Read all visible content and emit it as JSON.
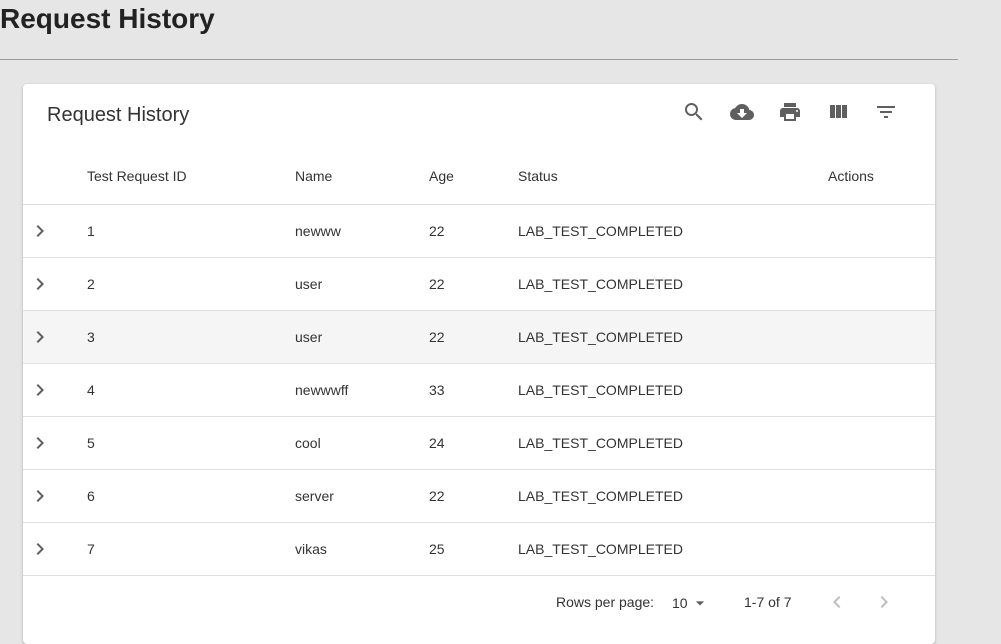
{
  "page": {
    "heading": "Request History"
  },
  "card": {
    "title": "Request History",
    "toolbar_icons": [
      "search-icon",
      "cloud-download-icon",
      "print-icon",
      "view-column-icon",
      "filter-list-icon"
    ]
  },
  "table": {
    "columns": [
      "Test Request ID",
      "Name",
      "Age",
      "Status",
      "Actions"
    ],
    "rows": [
      {
        "id": "1",
        "name": "newww",
        "age": "22",
        "status": "LAB_TEST_COMPLETED"
      },
      {
        "id": "2",
        "name": "user",
        "age": "22",
        "status": "LAB_TEST_COMPLETED"
      },
      {
        "id": "3",
        "name": "user",
        "age": "22",
        "status": "LAB_TEST_COMPLETED"
      },
      {
        "id": "4",
        "name": "newwwff",
        "age": "33",
        "status": "LAB_TEST_COMPLETED"
      },
      {
        "id": "5",
        "name": "cool",
        "age": "24",
        "status": "LAB_TEST_COMPLETED"
      },
      {
        "id": "6",
        "name": "server",
        "age": "22",
        "status": "LAB_TEST_COMPLETED"
      },
      {
        "id": "7",
        "name": "vikas",
        "age": "25",
        "status": "LAB_TEST_COMPLETED"
      }
    ]
  },
  "pagination": {
    "rows_per_page_label": "Rows per page:",
    "rows_per_page_value": "10",
    "range": "1-7 of 7"
  },
  "colors": {
    "background": "#e6e6e6",
    "card": "#ffffff",
    "hover_row": "#f5f5f5",
    "icon": "#5f5f5f",
    "disabled_icon": "#bdbdbd"
  }
}
